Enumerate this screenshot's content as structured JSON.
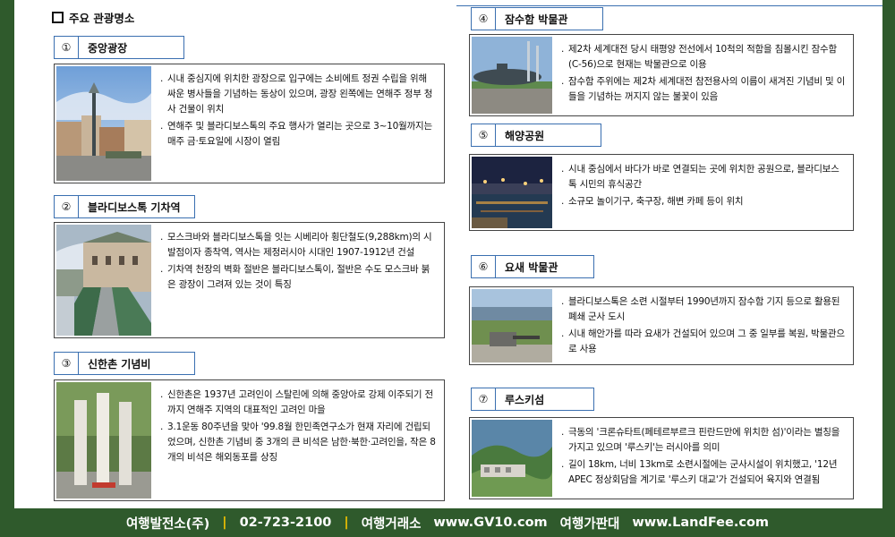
{
  "section_title": "주요 관광명소",
  "items": [
    {
      "num": "①",
      "name": "중앙광장",
      "bullets": [
        "시내 중심지에 위치한 광장으로 입구에는 소비에트 정권 수립을 위해 싸운 병사들을 기념하는 동상이 있으며, 광장 왼쪽에는 연해주 정부 청사 건물이 위치",
        "연해주 및 블라디보스톡의 주요 행사가 열리는 곳으로 3~10월까지는 매주 금·토요일에 시장이 열림"
      ]
    },
    {
      "num": "②",
      "name": "블라디보스톡 기차역",
      "bullets": [
        "모스크바와 블라디보스톡을 잇는 시베리아 횡단철도(9,288km)의 시발점이자 종착역, 역사는 제정러시아 시대인 1907-1912년 건설",
        "기차역 천장의 벽화 절반은 블라디보스톡이, 절반은 수도 모스크바 붉은 광장이 그려져 있는 것이 특징"
      ]
    },
    {
      "num": "③",
      "name": "신한촌 기념비",
      "bullets": [
        "신한촌은 1937년 고려인이 스탈린에 의해 중앙아로 강제 이주되기 전까지 연해주 지역의 대표적인 고려인 마을",
        "3.1운동 80주년을 맞아 '99.8월 한민족연구소가 현재 자리에 건립되었으며, 신한촌 기념비 중 3개의 큰 비석은 남한·북한·고려인을, 작은 8개의 비석은 해외동포를 상징"
      ]
    },
    {
      "num": "④",
      "name": "잠수함 박물관",
      "bullets": [
        "제2차 세계대전 당시 태평양 전선에서 10척의 적함을 침몰시킨 잠수함(C-56)으로 현재는 박물관으로 이용",
        "잠수함 주위에는 제2차 세계대전 참전용사의 이름이 새겨진 기념비 및 이들을 기념하는 꺼지지 않는 불꽃이 있음"
      ]
    },
    {
      "num": "⑤",
      "name": "해양공원",
      "bullets": [
        "시내 중심에서 바다가 바로 연결되는 곳에 위치한 공원으로, 블라디보스톡 시민의 휴식공간",
        "소규모 놀이기구, 축구장, 해변 카페 등이 위치"
      ]
    },
    {
      "num": "⑥",
      "name": "요새 박물관",
      "bullets": [
        "블라디보스톡은 소련 시절부터 1990년까지 잠수함 기지 등으로 활용된 폐쇄 군사 도시",
        "시내 해안가를 따라 요새가 건설되어 있으며 그 중 일부를 복원, 박물관으로 사용"
      ]
    },
    {
      "num": "⑦",
      "name": "루스키섬",
      "bullets": [
        "극동의 '크론슈타트(페테르부르크 핀란드만에 위치한 섬)'이라는 별칭을 가지고 있으며 '루스키'는 러시아를 의미",
        "길이 18km, 너비 13km로 소련시절에는 군사시설이 위치했고, '12년 APEC 정상회담을 계기로 '루스키 대교'가 건설되어 육지와 연결됨"
      ]
    }
  ],
  "footer": {
    "company": "여행발전소(주)",
    "phone": "02-723-2100",
    "label1": "여행거래소",
    "url1": "www.GV10.com",
    "label2": "여행가판대",
    "url2": "www.LandFee.com",
    "separator": "|"
  }
}
